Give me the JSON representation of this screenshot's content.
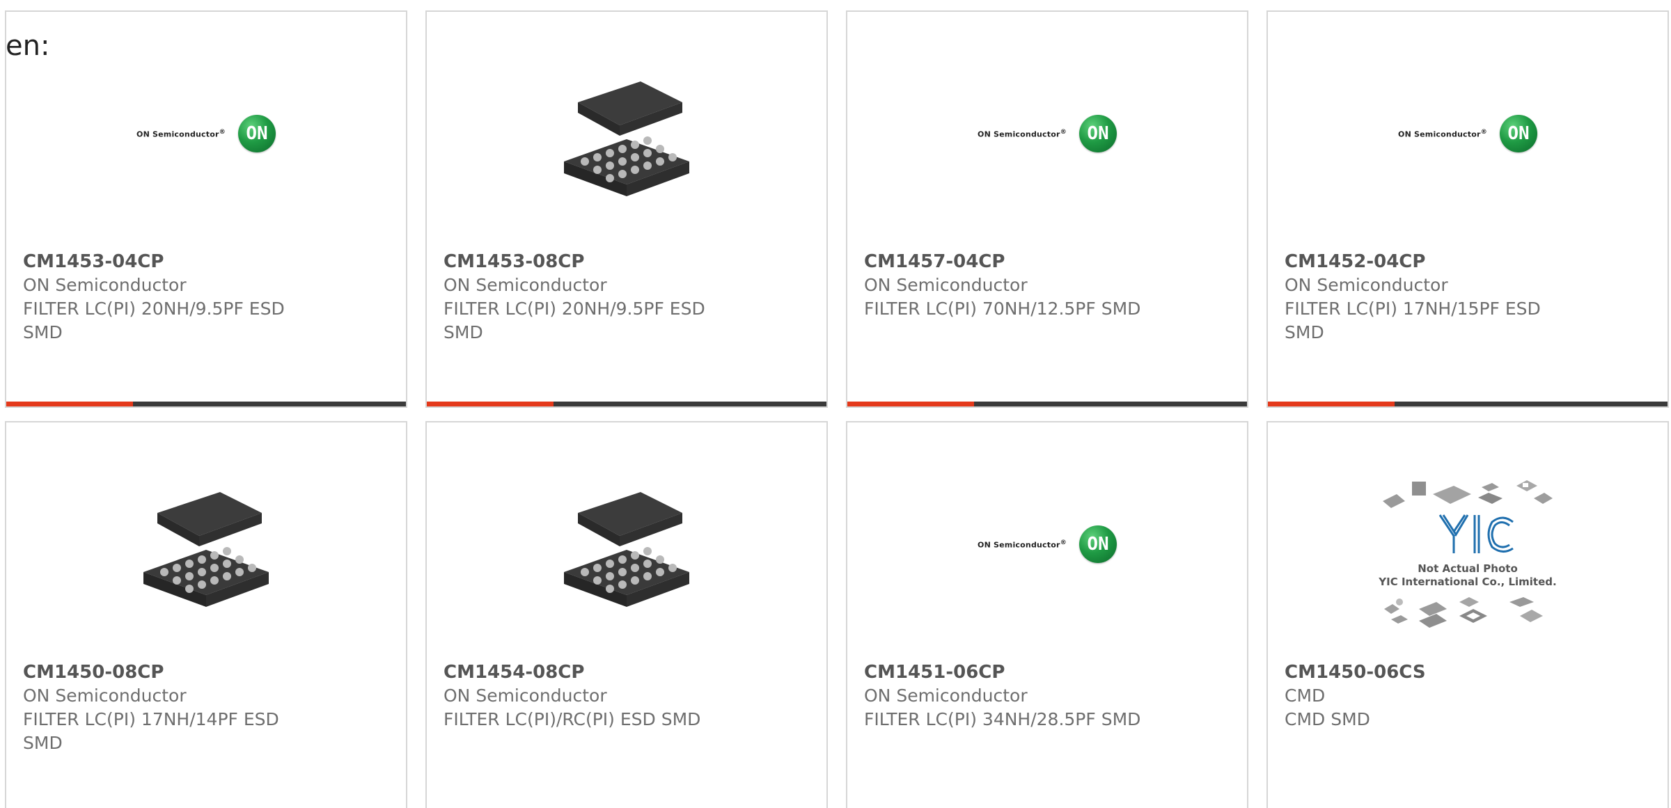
{
  "prefix": "en:",
  "brand": {
    "on_text": "ON Semiconductor",
    "on_trademark": "®",
    "on_badge": "ON",
    "accent_color": "#e4391b",
    "bar_color": "#3a3a3a",
    "logo_green": "#1f9a44"
  },
  "yic": {
    "line1": "Not Actual Photo",
    "line2": "YIC International Co., Limited."
  },
  "cards": [
    {
      "part": "CM1453-04CP",
      "maker": "ON Semiconductor",
      "desc": "FILTER LC(PI) 20NH/9.5PF ESD SMD",
      "image": "on-semi-logo-icon"
    },
    {
      "part": "CM1453-08CP",
      "maker": "ON Semiconductor",
      "desc": "FILTER LC(PI) 20NH/9.5PF ESD SMD",
      "image": "bga-chip-icon"
    },
    {
      "part": "CM1457-04CP",
      "maker": "ON Semiconductor",
      "desc": "FILTER LC(PI) 70NH/12.5PF SMD",
      "image": "on-semi-logo-icon"
    },
    {
      "part": "CM1452-04CP",
      "maker": "ON Semiconductor",
      "desc": "FILTER LC(PI) 17NH/15PF ESD SMD",
      "image": "on-semi-logo-icon"
    },
    {
      "part": "CM1450-08CP",
      "maker": "ON Semiconductor",
      "desc": "FILTER LC(PI) 17NH/14PF ESD SMD",
      "image": "bga-chip-icon"
    },
    {
      "part": "CM1454-08CP",
      "maker": "ON Semiconductor",
      "desc": "FILTER LC(PI)/RC(PI) ESD SMD",
      "image": "bga-chip-icon"
    },
    {
      "part": "CM1451-06CP",
      "maker": "ON Semiconductor",
      "desc": "FILTER LC(PI) 34NH/28.5PF SMD",
      "image": "on-semi-logo-icon"
    },
    {
      "part": "CM1450-06CS",
      "maker": "CMD",
      "desc": "CMD SMD",
      "image": "yic-placeholder-icon"
    }
  ]
}
